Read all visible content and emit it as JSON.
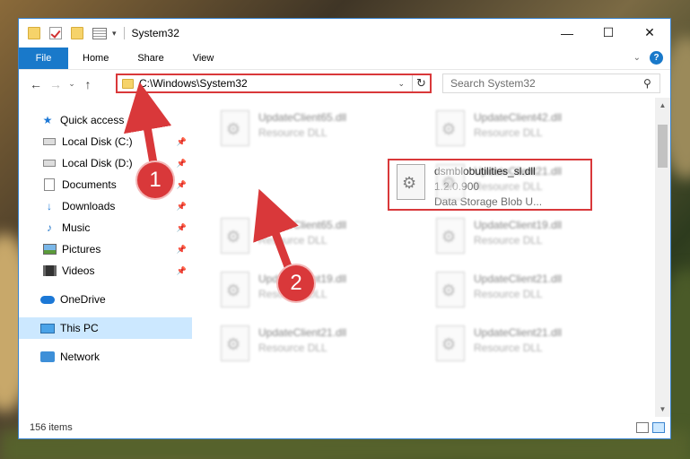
{
  "window": {
    "title": "System32"
  },
  "ribbon": {
    "tabs": [
      "File",
      "Home",
      "Share",
      "View"
    ]
  },
  "address": {
    "path": "C:\\Windows\\System32"
  },
  "search": {
    "placeholder": "Search System32"
  },
  "sidebar": {
    "items": [
      {
        "label": "Quick access",
        "icon": "star-icon",
        "pinned": false
      },
      {
        "label": "Local Disk (C:)",
        "icon": "drive-icon",
        "pinned": true
      },
      {
        "label": "Local Disk (D:)",
        "icon": "drive-icon",
        "pinned": true
      },
      {
        "label": "Documents",
        "icon": "documents-icon",
        "pinned": true
      },
      {
        "label": "Downloads",
        "icon": "downloads-icon",
        "pinned": true
      },
      {
        "label": "Music",
        "icon": "music-icon",
        "pinned": true
      },
      {
        "label": "Pictures",
        "icon": "pictures-icon",
        "pinned": true
      },
      {
        "label": "Videos",
        "icon": "videos-icon",
        "pinned": true
      },
      {
        "label": "OneDrive",
        "icon": "onedrive-icon",
        "pinned": false
      },
      {
        "label": "This PC",
        "icon": "this-pc-icon",
        "pinned": false,
        "selected": true
      },
      {
        "label": "Network",
        "icon": "network-icon",
        "pinned": false
      }
    ]
  },
  "files": [
    {
      "name": "UpdateClient65.dll",
      "sub": "Resource DLL"
    },
    {
      "name": "UpdateClient42.dll",
      "sub": "Resource DLL"
    },
    {
      "name": "dsmblobutilities_sl.dll",
      "version": "1.2.0.900",
      "sub": "Data Storage Blob U..."
    },
    {
      "name": "UpdateClient21.dll",
      "sub": "Resource DLL"
    },
    {
      "name": "UpdateClient65.dll",
      "sub": "Resource DLL"
    },
    {
      "name": "UpdateClient19.dll",
      "sub": "Resource DLL"
    },
    {
      "name": "UpdateClient19.dll",
      "sub": "Resource DLL"
    },
    {
      "name": "UpdateClient21.dll",
      "sub": "Resource DLL"
    },
    {
      "name": "UpdateClient21.dll",
      "sub": "Resource DLL"
    },
    {
      "name": "UpdateClient21.dll",
      "sub": "Resource DLL"
    }
  ],
  "status": {
    "count": "156 items"
  },
  "callouts": [
    "1",
    "2"
  ],
  "colors": {
    "accent": "#1979ca",
    "highlight": "#d9383a",
    "selected": "#cce8ff"
  }
}
